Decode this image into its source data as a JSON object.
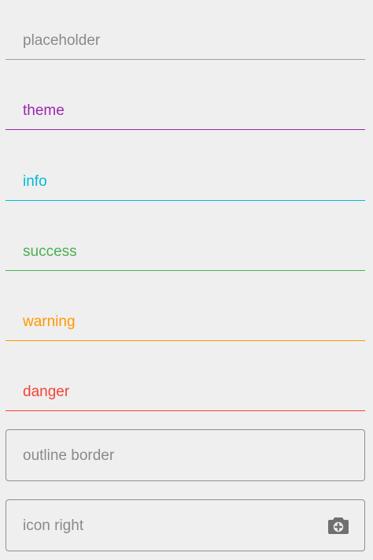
{
  "fields": [
    {
      "label": "placeholder",
      "color": "#8a8a8a",
      "line": "#9e9e9e"
    },
    {
      "label": "theme",
      "color": "#9c27b0",
      "line": "#9c27b0"
    },
    {
      "label": "info",
      "color": "#00bcd4",
      "line": "#00bcd4"
    },
    {
      "label": "success",
      "color": "#4caf50",
      "line": "#4caf50"
    },
    {
      "label": "warning",
      "color": "#ff9800",
      "line": "#ff9800"
    },
    {
      "label": "danger",
      "color": "#f44336",
      "line": "#f44336"
    }
  ],
  "outline_field": {
    "label": "outline border"
  },
  "icon_field": {
    "label": "icon right",
    "icon": "camera-icon"
  }
}
